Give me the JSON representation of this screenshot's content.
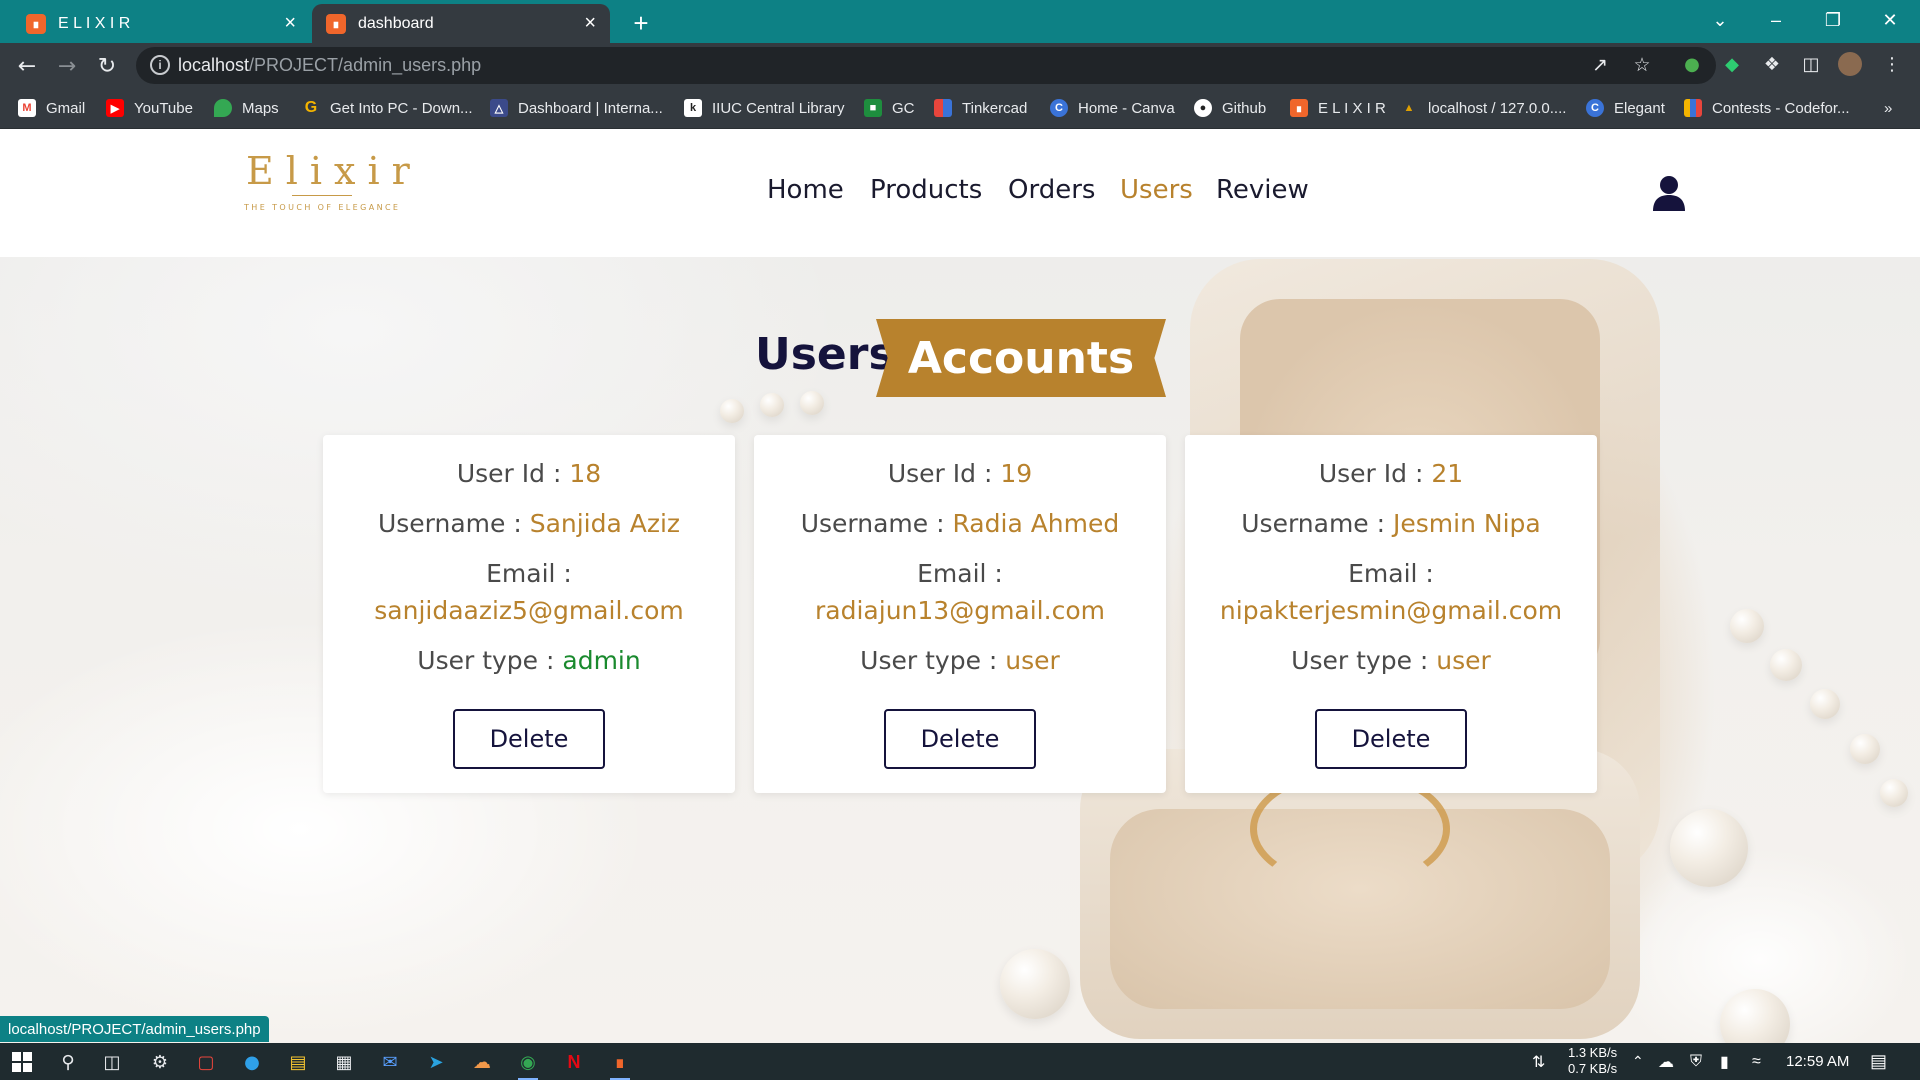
{
  "browser": {
    "tabs": [
      {
        "title": "E L I X I R",
        "favicon": "xampp-icon"
      },
      {
        "title": "dashboard",
        "favicon": "xampp-icon",
        "active": true
      }
    ],
    "url_host": "localhost",
    "url_path": "/PROJECT/admin_users.php",
    "bookmarks": [
      {
        "label": "Gmail",
        "icon": "gmail-icon",
        "color": "#ea4335"
      },
      {
        "label": "YouTube",
        "icon": "youtube-icon",
        "color": "#ff0000"
      },
      {
        "label": "Maps",
        "icon": "maps-icon",
        "color": "#34a853"
      },
      {
        "label": "Get Into PC - Down...",
        "icon": "g-icon",
        "color": "#f4b400"
      },
      {
        "label": "Dashboard | Interna...",
        "icon": "university-icon",
        "color": "#3b4a8a"
      },
      {
        "label": "IIUC Central Library",
        "icon": "library-icon",
        "color": "#222222"
      },
      {
        "label": "GC",
        "icon": "classroom-icon",
        "color": "#1e8e3e"
      },
      {
        "label": "Tinkercad",
        "icon": "tinkercad-icon",
        "color": "#e8453c"
      },
      {
        "label": "Home - Canva",
        "icon": "canva-icon",
        "color": "#3a73d8"
      },
      {
        "label": "Github",
        "icon": "github-icon",
        "color": "#ffffff"
      },
      {
        "label": "E L I X I R",
        "icon": "xampp-icon",
        "color": "#f0662b"
      },
      {
        "label": "localhost / 127.0.0....",
        "icon": "phpmyadmin-icon",
        "color": "#e0a000"
      },
      {
        "label": "Elegant",
        "icon": "canva-icon",
        "color": "#3a73d8"
      },
      {
        "label": "Contests - Codefor...",
        "icon": "codeforces-icon",
        "color": "#f4b400"
      }
    ],
    "overflow": "»",
    "status_url": "localhost/PROJECT/admin_users.php"
  },
  "site": {
    "logo_text": "Elixir",
    "logo_tagline": "THE TOUCH OF ELEGANCE",
    "nav": [
      {
        "label": "Home",
        "active": false
      },
      {
        "label": "Products",
        "active": false
      },
      {
        "label": "Orders",
        "active": false
      },
      {
        "label": "Users",
        "active": true
      },
      {
        "label": "Review",
        "active": false
      }
    ],
    "heading_plain": "Users",
    "heading_badge": "Accounts",
    "accent_color": "#b8822d",
    "dark_color": "#15133c"
  },
  "users": [
    {
      "id_label": "User Id :",
      "id": "18",
      "username_label": "Username :",
      "username": "Sanjida Aziz",
      "email_label": "Email :",
      "email": "sanjidaaziz5@gmail.com",
      "type_label": "User type :",
      "type": "admin",
      "delete_label": "Delete"
    },
    {
      "id_label": "User Id :",
      "id": "19",
      "username_label": "Username :",
      "username": "Radia Ahmed",
      "email_label": "Email :",
      "email": "radiajun13@gmail.com",
      "type_label": "User type :",
      "type": "user",
      "delete_label": "Delete"
    },
    {
      "id_label": "User Id :",
      "id": "21",
      "username_label": "Username :",
      "username": "Jesmin Nipa",
      "email_label": "Email :",
      "email": "nipakterjesmin@gmail.com",
      "type_label": "User type :",
      "type": "user",
      "delete_label": "Delete"
    }
  ],
  "taskbar": {
    "net_up": "1.3 KB/s",
    "net_down": "0.7 KB/s",
    "time": "12:59 AM"
  }
}
